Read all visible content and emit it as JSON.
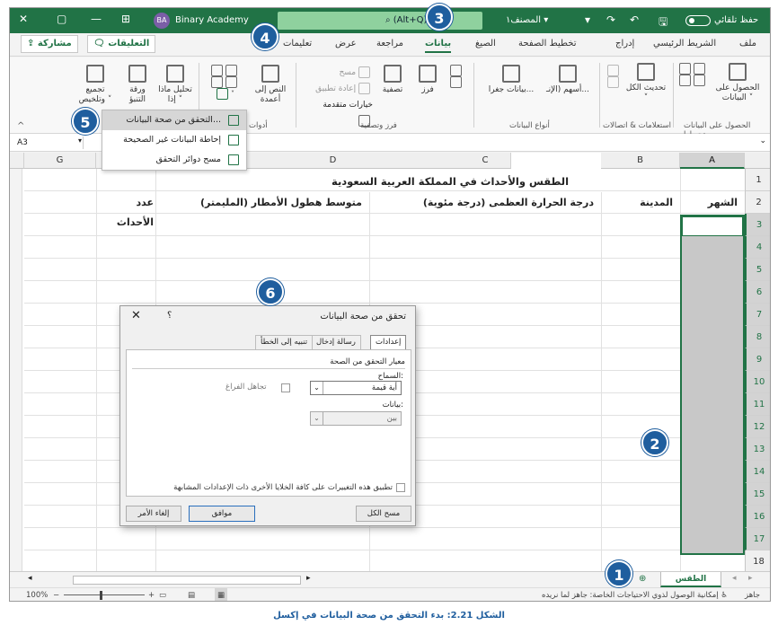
{
  "titlebar": {
    "autosave_label": "حفظ تلقائي",
    "workbook_name": "المصنف١",
    "search_shortcut": "(Alt+Q)",
    "account_initials": "BA",
    "account_name": "Binary Academy"
  },
  "menu_tabs": [
    "ملف",
    "الشريط الرئيسي",
    "إدراج",
    "تخطيط الصفحة",
    "الصيغ",
    "بيانات",
    "مراجعة",
    "عرض",
    "تعليمات"
  ],
  "active_tab": "بيانات",
  "share_label": "مشاركة",
  "comments_label": "التعليقات",
  "ribbon": {
    "get_data": "الحصول على البيانات ˅",
    "refresh_all": "تحديث الكل ˅",
    "stocks": "أسهم (الإنـ...",
    "geography": "بيانات جغرا...",
    "sort": "فرز",
    "filter": "تصفية",
    "clear": "مسح",
    "reapply": "إعادة تطبيق",
    "advanced": "خيارات متقدمة",
    "text_to_columns": "النص إلى أعمدة",
    "what_if": "تحليل ماذا إذا ˅",
    "forecast_sheet": "ورقة التنبؤ",
    "outline": "تجميع وتلخيص ˅",
    "groups": {
      "get_transform": "الحصول على البيانات وتحويلها",
      "queries": "استعلامات & اتصالات",
      "data_types": "أنواع البيانات",
      "sort_filter": "فرز وتصفية",
      "tools": "أدوات"
    }
  },
  "dv_menu": [
    "التحقق من صحة البيانات...",
    "إحاطة البيانات غير الصحيحة",
    "مسح دوائر التحقق"
  ],
  "formula_bar": {
    "name_box": "A3"
  },
  "columns": [
    "A",
    "B",
    "C",
    "D",
    "G"
  ],
  "rows": [
    "1",
    "2",
    "3",
    "4",
    "5",
    "6",
    "7",
    "8",
    "9",
    "10",
    "11",
    "12",
    "13",
    "14",
    "15",
    "16",
    "17",
    "18"
  ],
  "sheet_title": "الطقس والأحداث في المملكة العربية السعودية",
  "headers": [
    "الشهر",
    "المدينة",
    "درجة الحرارة العظمى (درجة مئوية)",
    "متوسط هطول الأمطار (المليمتر)",
    "عدد الأحداث"
  ],
  "dialog": {
    "title": "تحقق من صحة البيانات",
    "help": "؟",
    "close": "✕",
    "tabs": [
      "إعدادات",
      "رسالة إدخال",
      "تنبيه إلى الخطأ"
    ],
    "criteria_label": "معيار التحقق من الصحة",
    "allow_label": "السماح:",
    "allow_value": "أية قيمة",
    "ignore_blank": "تجاهل الفراغ",
    "data_label": "بيانات:",
    "data_value": "بين",
    "apply_all": "تطبيق هذه التغييرات على كافة الخلايا الأخرى ذات الإعدادات المشابهة",
    "clear_all": "مسح الكل",
    "ok": "موافق",
    "cancel": "إلغاء الأمر"
  },
  "sheet_tab": "الطقس والأحداث",
  "status": {
    "ready": "جاهز",
    "accessibility": "إمكانية الوصول لذوي الاحتياجات الخاصة: جاهز لما نريده",
    "zoom": "100%"
  },
  "callouts": [
    "1",
    "2",
    "3",
    "4",
    "5",
    "6"
  ],
  "caption": "الشكل 2.21: بدء التحقق من صحة البيانات في إكسل",
  "colors": {
    "excel_green": "#217346",
    "callout_blue": "#1f5e9e"
  }
}
